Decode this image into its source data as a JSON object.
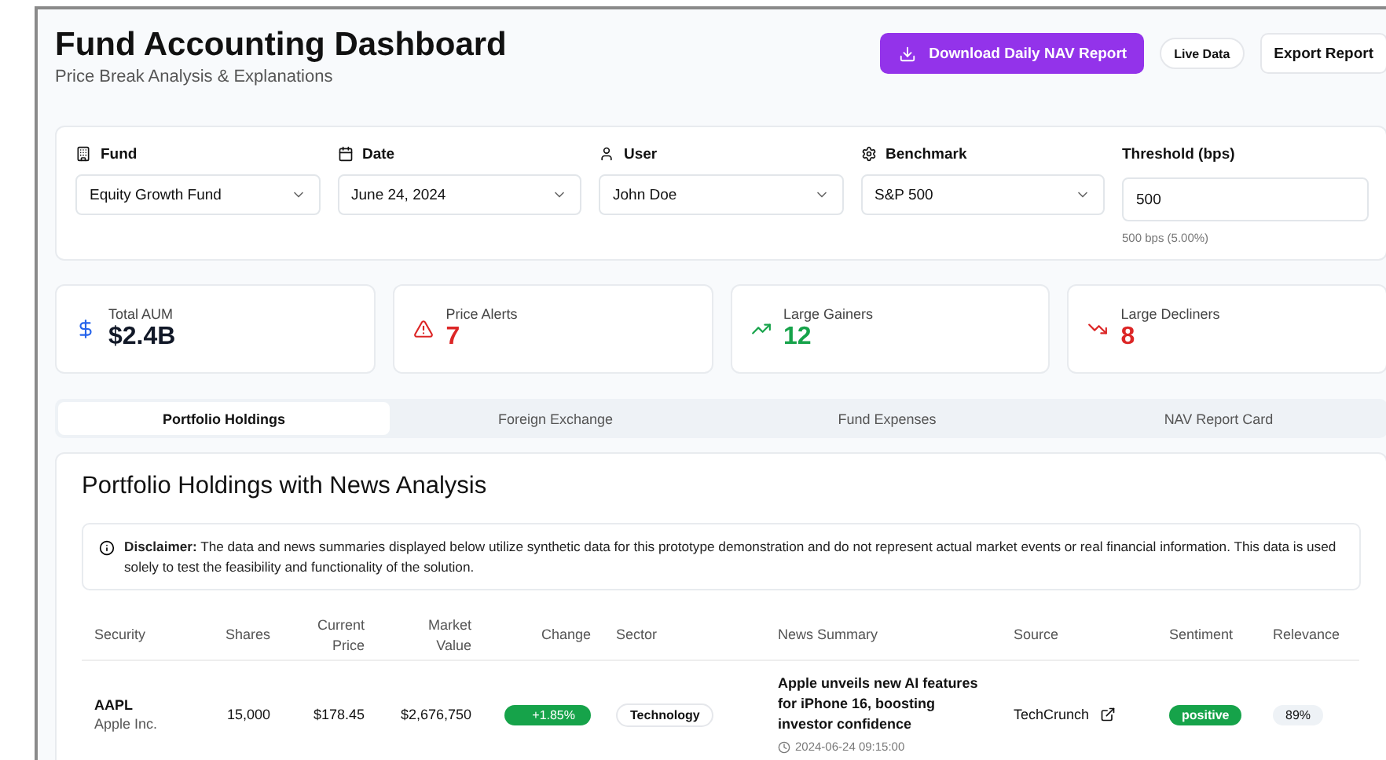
{
  "header": {
    "title": "Fund Accounting Dashboard",
    "subtitle": "Price Break Analysis & Explanations",
    "buttons": [
      {
        "kind": "primary",
        "label": "Download Daily NAV Report"
      },
      {
        "kind": "badge",
        "label": "Live Data"
      },
      {
        "kind": "outline",
        "label": "Export Report"
      }
    ]
  },
  "filters": [
    {
      "kind": "select",
      "label": "Fund",
      "value": "Equity Growth Fund"
    },
    {
      "kind": "select",
      "label": "Date",
      "value": "June 24, 2024"
    },
    {
      "kind": "select",
      "label": "User",
      "value": "John Doe"
    },
    {
      "kind": "select",
      "label": "Benchmark",
      "value": "S&P 500"
    },
    {
      "kind": "input",
      "label": "Threshold (bps)",
      "value": "500",
      "hint": "500 bps (5.00%)"
    }
  ],
  "stats": [
    {
      "label": "Total AUM",
      "value": "$2.4B",
      "color": "#111827"
    },
    {
      "label": "Price Alerts",
      "value": "7",
      "color": "#dc2626"
    },
    {
      "label": "Large Gainers",
      "value": "12",
      "color": "#16a34a"
    },
    {
      "label": "Large Decliners",
      "value": "8",
      "color": "#dc2626"
    }
  ],
  "tabs": [
    {
      "label": "Portfolio Holdings",
      "selected": true
    },
    {
      "label": "Foreign Exchange",
      "selected": false
    },
    {
      "label": "Fund Expenses",
      "selected": false
    },
    {
      "label": "NAV Report Card",
      "selected": false
    }
  ],
  "panel": {
    "title": "Portfolio Holdings with News Analysis",
    "disclaimer": "**Disclaimer:** The data and news summaries displayed below utilize synthetic data for this prototype demonstration and do not represent actual market events or real financial information. This data is used solely to test the feasibility and functionality of the solution.",
    "table": {
      "columns": [
        "Security",
        "Shares",
        "Current Price",
        "Market Value",
        "Change",
        "Sector",
        "News Summary",
        "Source",
        "Sentiment",
        "Relevance"
      ],
      "rows": [
        {
          "ticker": "AAPL",
          "name": "Apple Inc.",
          "shares": "15,000",
          "price": "$178.45",
          "value": "$2,676,750",
          "change": "+1.85%",
          "sector": "Technology",
          "headline": "Apple unveils new AI features for iPhone 16, boosting investor confidence",
          "time": "2024-06-24 09:15:00",
          "source": "TechCrunch",
          "sentiment": "positive",
          "relevance": "89%"
        }
      ]
    }
  }
}
